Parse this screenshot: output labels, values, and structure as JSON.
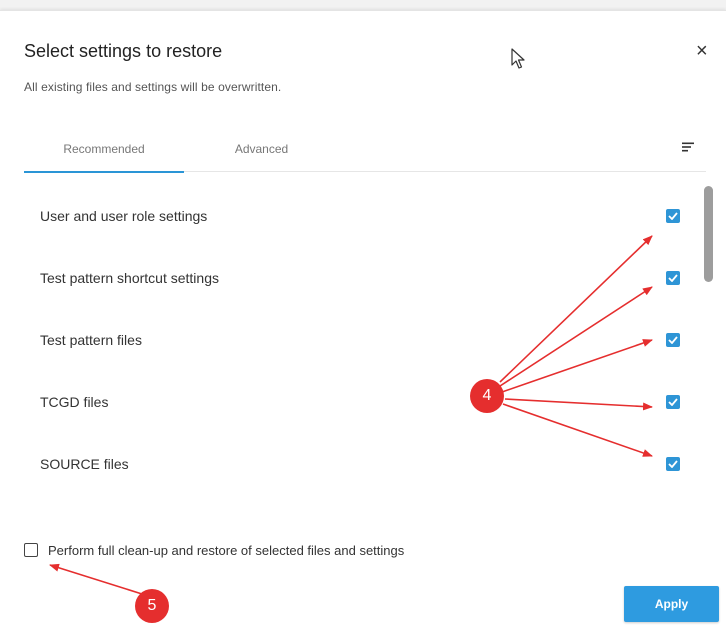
{
  "dialog": {
    "title": "Select settings to restore",
    "subtitle": "All existing files and settings will be overwritten.",
    "close_icon": "×"
  },
  "tabs": [
    {
      "label": "Recommended",
      "active": true
    },
    {
      "label": "Advanced",
      "active": false
    }
  ],
  "settings": [
    {
      "label": "User and user role settings",
      "checked": true
    },
    {
      "label": "Test pattern shortcut settings",
      "checked": true
    },
    {
      "label": "Test pattern files",
      "checked": true
    },
    {
      "label": "TCGD files",
      "checked": true
    },
    {
      "label": "SOURCE files",
      "checked": true
    }
  ],
  "footer": {
    "cleanup_label": "Perform full clean-up and restore of selected files and settings",
    "cleanup_checked": false,
    "apply_label": "Apply"
  },
  "annotations": [
    {
      "number": "4"
    },
    {
      "number": "5"
    }
  ],
  "colors": {
    "accent": "#2e95d6",
    "annotation": "#e52e2e"
  },
  "icons": [
    "close-icon",
    "sort-icon",
    "cursor-icon",
    "check-icon"
  ]
}
